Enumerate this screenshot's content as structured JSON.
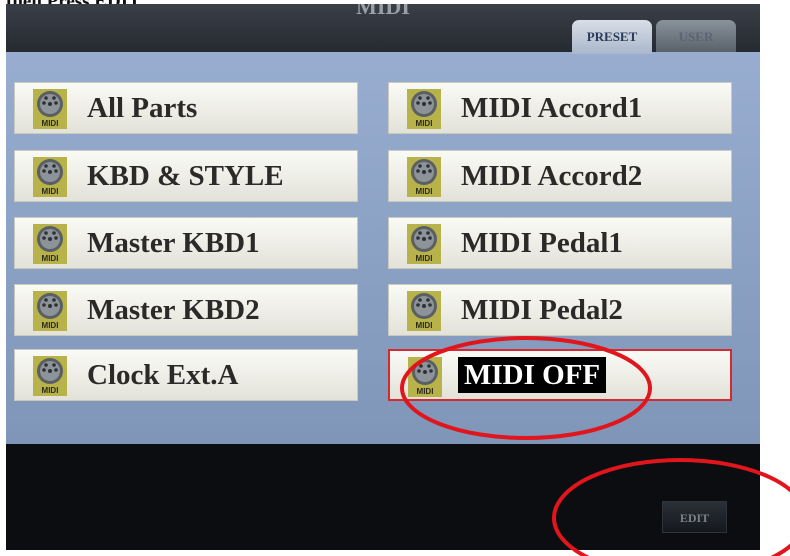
{
  "caption": "then Press EDIT",
  "screen": {
    "title": "MIDI",
    "tabs": [
      {
        "label": "PRESET",
        "active": true
      },
      {
        "label": "USER",
        "active": false
      }
    ],
    "icon_label": "MIDI",
    "left_items": [
      {
        "label": "All Parts"
      },
      {
        "label": "KBD & STYLE"
      },
      {
        "label": "Master KBD1"
      },
      {
        "label": "Master KBD2"
      },
      {
        "label": "Clock Ext.A"
      }
    ],
    "right_items": [
      {
        "label": "MIDI Accord1"
      },
      {
        "label": "MIDI Accord2"
      },
      {
        "label": "MIDI Pedal1"
      },
      {
        "label": "MIDI Pedal2"
      },
      {
        "label": "MIDI OFF",
        "selected": true
      }
    ],
    "edit_label": "EDIT"
  },
  "colors": {
    "panel": "#8fa5c3",
    "selection_border": "#d42a30",
    "annotation": "#e0161c"
  }
}
